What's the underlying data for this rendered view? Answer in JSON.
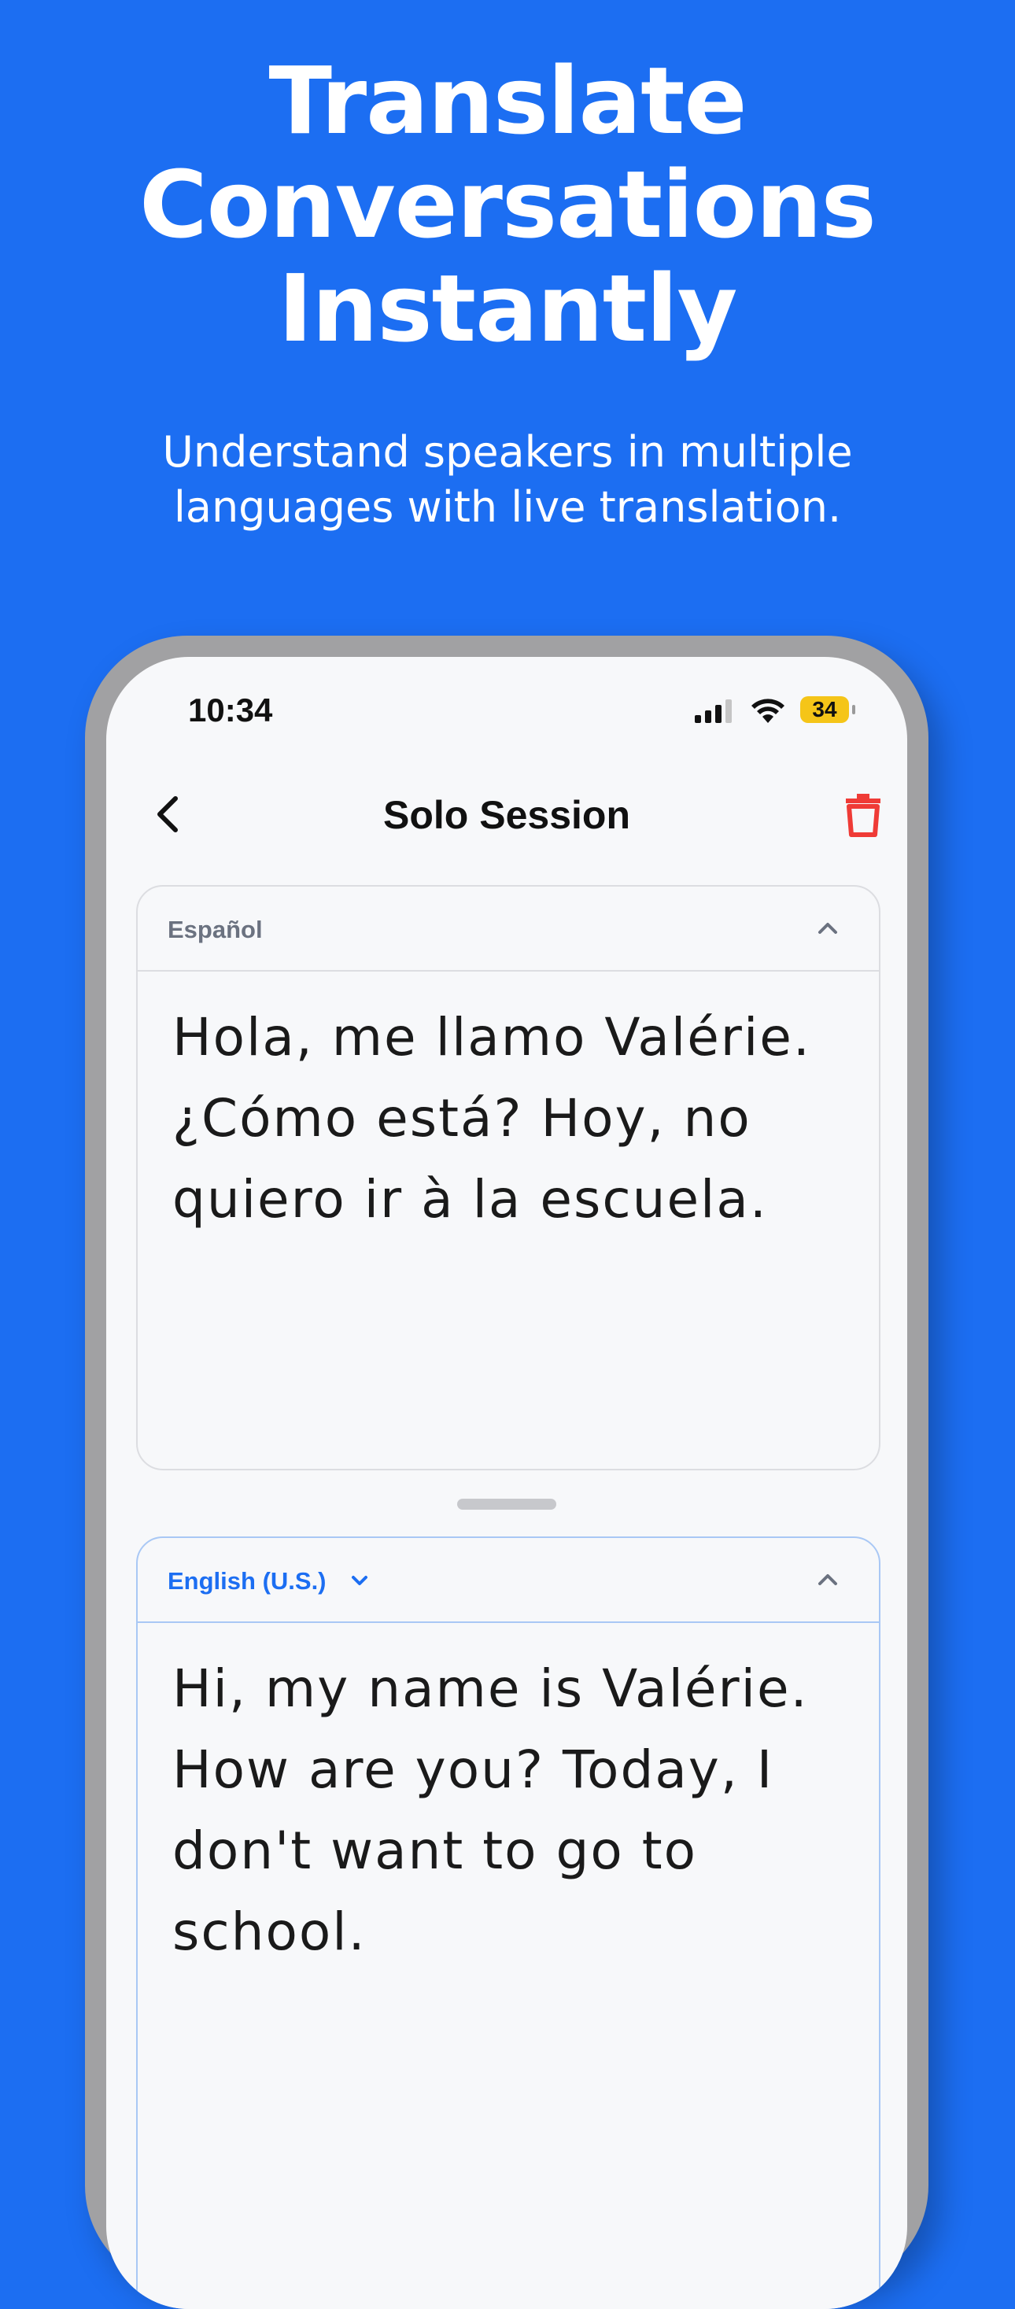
{
  "hero": {
    "title_lines": [
      "Translate",
      "Conversations",
      "Instantly"
    ],
    "subtitle_lines": [
      "Understand speakers in multiple",
      "languages with live translation."
    ]
  },
  "status_bar": {
    "time": "10:34",
    "battery": "34"
  },
  "nav": {
    "title": "Solo Session"
  },
  "source_panel": {
    "language": "Español",
    "text": "Hola, me llamo Valérie. ¿Cómo está? Hoy, no quiero ir à la escuela."
  },
  "target_panel": {
    "language": "English (U.S.)",
    "text": "Hi, my name is Valérie. How are you? Today, I don't want to go to school."
  },
  "colors": {
    "background": "#1c6ef2",
    "accent": "#1c6ef2",
    "delete": "#ef3b36",
    "battery": "#f5c518"
  }
}
